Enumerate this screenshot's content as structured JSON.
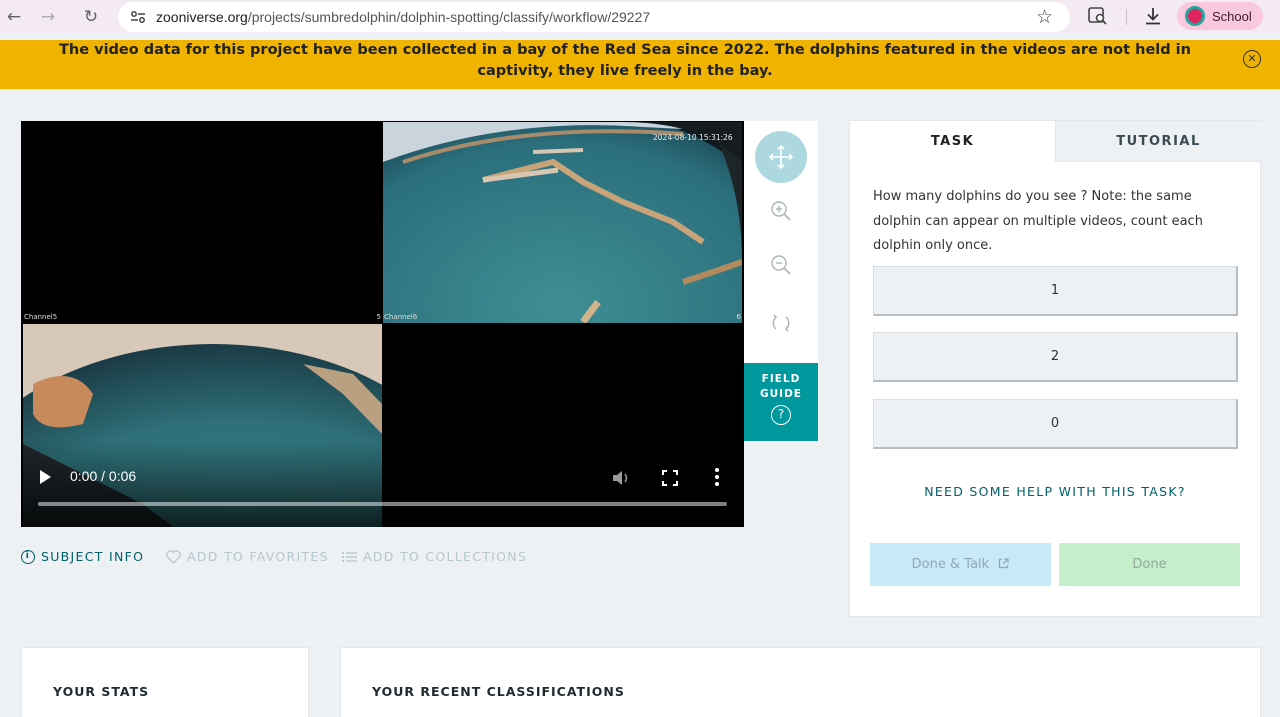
{
  "browser": {
    "url_host": "zooniverse.org",
    "url_path": "/projects/sumbredolphin/dolphin-spotting/classify/workflow/29227",
    "profile_label": "School"
  },
  "banner": {
    "text": "The video data for this project have been collected in a bay of the Red Sea since 2022. The dolphins featured in the videos are not held in captivity, they live freely in the bay.",
    "close_glyph": "✕"
  },
  "video": {
    "channel5_label": "Channel5",
    "channel6_label": "Channel6",
    "channel6_suffix": "6",
    "channel5_suffix": "5",
    "timestamp": "2024-08-10 15:31:26",
    "time_display": "0:00 / 0:06",
    "progress_fraction": 0
  },
  "tools": {
    "field_guide_line1": "FIELD",
    "field_guide_line2": "GUIDE",
    "field_guide_glyph": "?"
  },
  "meta_links": {
    "subject_info": "SUBJECT INFO",
    "add_favorites": "ADD TO FAVORITES",
    "add_collections": "ADD TO COLLECTIONS",
    "info_glyph": "i"
  },
  "task_panel": {
    "tabs": [
      {
        "label": "TASK",
        "active": true
      },
      {
        "label": "TUTORIAL",
        "active": false
      }
    ],
    "question": "How many dolphins do you see ? Note: the same dolphin can appear on multiple videos, count each dolphin only once.",
    "answers": [
      "1",
      "2",
      "0"
    ],
    "help_link": "NEED SOME HELP WITH THIS TASK?",
    "done_talk_label": "Done & Talk",
    "done_label": "Done"
  },
  "cards": {
    "stats_title": "YOUR STATS",
    "recent_title": "YOUR RECENT CLASSIFICATIONS"
  },
  "colors": {
    "banner_bg": "#f0b400",
    "accent_teal": "#00979d",
    "link_teal": "#00606b",
    "done_green": "#c5efcb",
    "talk_blue": "#c8e9fa"
  }
}
